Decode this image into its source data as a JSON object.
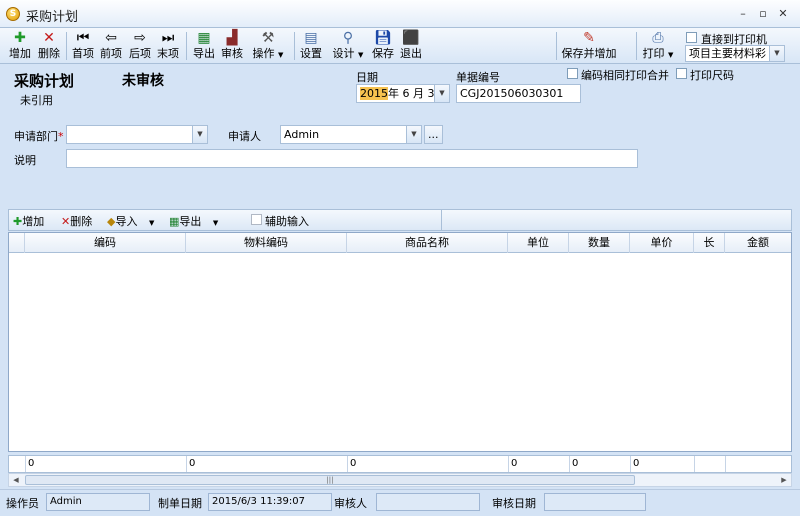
{
  "window": {
    "title": "采购计划",
    "app_icon": "S"
  },
  "toolbar": {
    "add": "增加",
    "delete": "删除",
    "first": "首项",
    "prev": "前项",
    "next": "后项",
    "last": "末项",
    "export": "导出",
    "audit": "审核",
    "operate": "操作",
    "settings": "设置",
    "design": "设计",
    "save": "保存",
    "exit": "退出",
    "save_and_add": "保存并增加",
    "print": "打印",
    "direct_print": "直接到打印机",
    "print_template": "项目主要材料彩"
  },
  "header": {
    "form_title": "采购计划",
    "status": "未审核",
    "reference": "未引用",
    "date_label": "日期",
    "date_year": "2015",
    "date_rest": "年 6 月 3 日",
    "docno_label": "单据编号",
    "docno_value": "CGJ201506030301",
    "merge_same_code": "编码相同打印合并",
    "print_size": "打印尺码",
    "dept_label": "申请部门",
    "dept_value": "",
    "applicant_label": "申请人",
    "applicant_value": "Admin",
    "browse": "...",
    "note_label": "说明",
    "note_value": ""
  },
  "detail_toolbar": {
    "add": "增加",
    "delete": "删除",
    "import": "导入",
    "export": "导出",
    "assist_input": "辅助输入"
  },
  "grid": {
    "columns": [
      "编码",
      "物料编码",
      "商品名称",
      "单位",
      "数量",
      "单价",
      "长",
      "金额"
    ],
    "totals": [
      "0",
      "0",
      "0",
      "0",
      "0",
      "0"
    ]
  },
  "statusbar": {
    "operator_label": "操作员",
    "operator_value": "Admin",
    "created_label": "制单日期",
    "created_value": "2015/6/3 11:39:07",
    "auditor_label": "审核人",
    "auditor_value": "",
    "audit_date_label": "审核日期",
    "audit_date_value": ""
  }
}
